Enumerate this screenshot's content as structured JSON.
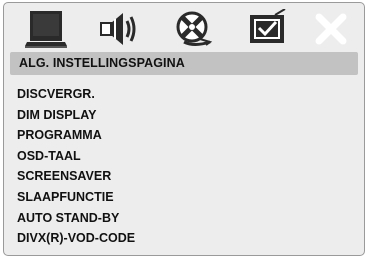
{
  "tabs": [
    {
      "icon": "tv-monitor-icon"
    },
    {
      "icon": "speaker-sound-icon"
    },
    {
      "icon": "video-reel-icon"
    },
    {
      "icon": "checkbox-preferences-icon"
    },
    {
      "icon": "close-icon"
    }
  ],
  "header": {
    "title": "ALG. INSTELLINGSPAGINA"
  },
  "menu": {
    "items": [
      {
        "label": "DISCVERGR."
      },
      {
        "label": "DIM DISPLAY"
      },
      {
        "label": "PROGRAMMA"
      },
      {
        "label": "OSD-TAAL"
      },
      {
        "label": "SCREENSAVER"
      },
      {
        "label": "SLAAPFUNCTIE"
      },
      {
        "label": "AUTO STAND-BY"
      },
      {
        "label": "DIVX(R)-VOD-CODE"
      }
    ]
  },
  "colors": {
    "panel": "#ededed",
    "header": "#c2c2c2",
    "icon_dark": "#2a2a2a",
    "icon_light": "#ffffff"
  }
}
